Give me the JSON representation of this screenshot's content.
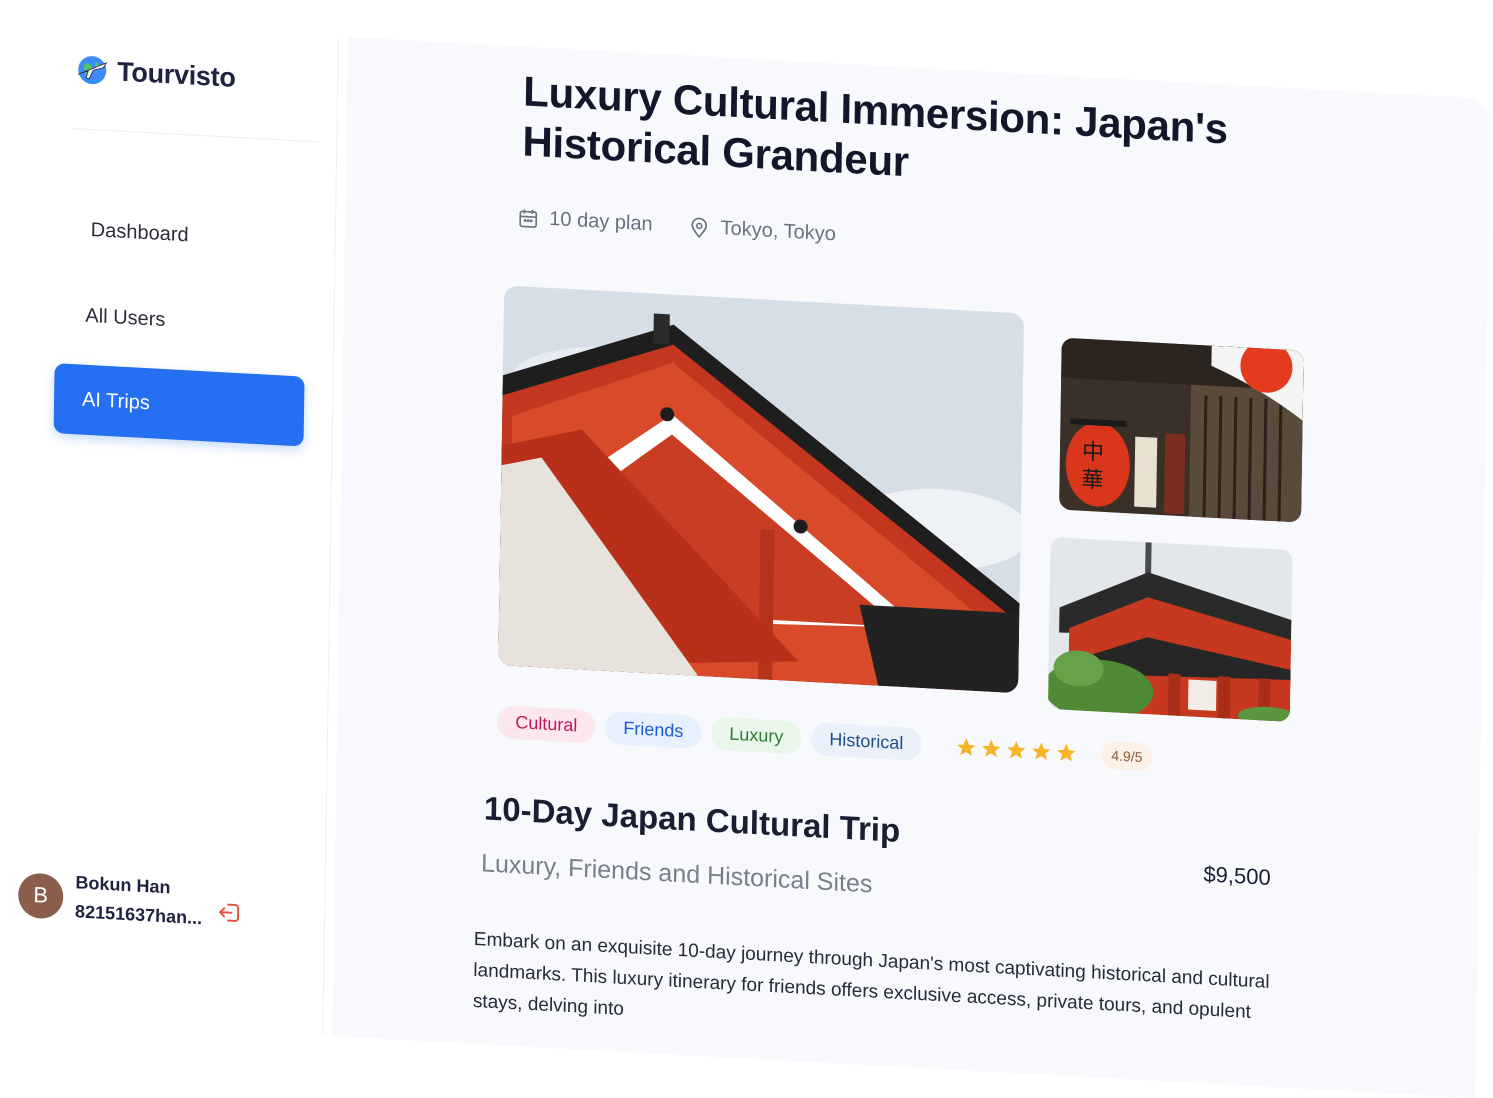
{
  "app": {
    "name": "Tourvisto"
  },
  "sidebar": {
    "items": [
      {
        "label": "Dashboard"
      },
      {
        "label": "All Users"
      },
      {
        "label": "AI Trips"
      }
    ]
  },
  "user": {
    "initial": "B",
    "name": "Bokun Han",
    "id": "82151637han..."
  },
  "trip": {
    "title": "Luxury Cultural Immersion: Japan's Historical Grandeur",
    "duration": "10 day plan",
    "location": "Tokyo, Tokyo",
    "tags": [
      "Cultural",
      "Friends",
      "Luxury",
      "Historical"
    ],
    "rating": {
      "value": 5,
      "text": "4.9/5"
    },
    "name": "10-Day Japan Cultural Trip",
    "subtitle": "Luxury, Friends and Historical Sites",
    "price": "$9,500",
    "description": "Embark on an exquisite 10-day journey through Japan's most captivating historical and cultural landmarks. This luxury itinerary for friends offers exclusive access, private tours, and opulent stays, delving into"
  },
  "colors": {
    "accent": "#256ff1",
    "star": "#f6b427",
    "logout": "#e0573b"
  }
}
